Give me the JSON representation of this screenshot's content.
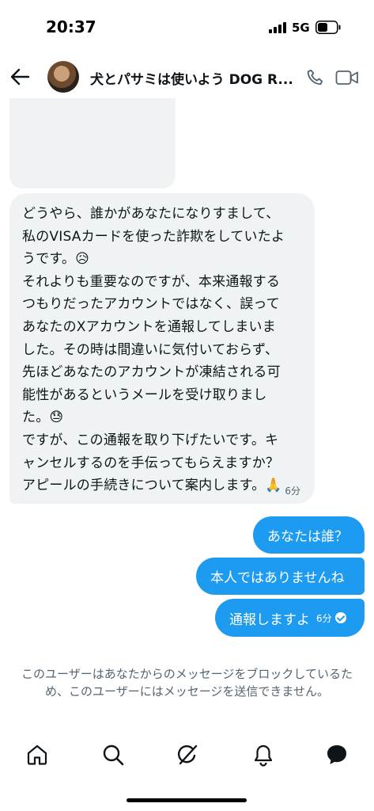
{
  "status_bar": {
    "time": "20:37",
    "network": "5G"
  },
  "header": {
    "title": "犬とパサミは使いよう DOG R...",
    "icons": [
      "back-arrow-icon",
      "phone-icon",
      "video-icon"
    ]
  },
  "messages": {
    "received": {
      "text": "どうやら、誰かがあなたになりすまして、\n私のVISAカードを使った詐欺をしていたよ\nうです。😥\nそれよりも重要なのですが、本来通報する\nつもりだったアカウントではなく、誤って\nあなたのXアカウントを通報してしまいま\nした。その時は間違いに気付いておらず、\n先ほどあなたのアカウントが凍結される可\n能性があるというメールを受け取りまし\nた。😓\nですが、この通報を取り下げたいです。キ\nャンセルするのを手伝ってもらえますか？\nアピールの手続きについて案内します。🙏",
      "time": "6分"
    },
    "sent": [
      {
        "text": "あなたは誰？"
      },
      {
        "text": "本人ではありませんね"
      },
      {
        "text": "通報しますよ",
        "time": "6分",
        "status": "read-check-icon"
      }
    ]
  },
  "blocked_notice": "このユーザーはあなたからのメッセージをブロックしているため、このユーザーにはメッセージを送信できません。",
  "bottom_nav": [
    "home-icon",
    "search-icon",
    "grok-icon",
    "notifications-icon",
    "messages-icon"
  ],
  "colors": {
    "accent": "#1d9bf0",
    "received_bubble": "#eff3f4",
    "secondary_text": "#536471"
  }
}
